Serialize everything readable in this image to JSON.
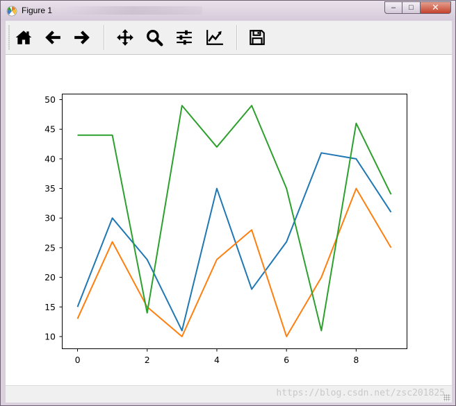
{
  "window": {
    "title": "Figure 1",
    "minimize_label": "–",
    "maximize_label": "□",
    "close_label": "✕"
  },
  "toolbar": {
    "tools": [
      {
        "name": "home-icon"
      },
      {
        "name": "back-arrow-icon"
      },
      {
        "name": "forward-arrow-icon"
      },
      {
        "name": "pan-move-icon"
      },
      {
        "name": "zoom-magnifier-icon"
      },
      {
        "name": "subplots-sliders-icon"
      },
      {
        "name": "edit-axis-curve-icon"
      },
      {
        "name": "save-floppy-icon"
      }
    ]
  },
  "status": {
    "watermark": "https://blog.csdn.net/zsc201825"
  },
  "colors": {
    "series": [
      "#1f77b4",
      "#ff7f0e",
      "#2ca02c"
    ]
  },
  "chart_data": {
    "type": "line",
    "title": "",
    "xlabel": "",
    "ylabel": "",
    "x": [
      0,
      1,
      2,
      3,
      4,
      5,
      6,
      7,
      8,
      9
    ],
    "xlim": [
      -0.45,
      9.45
    ],
    "ylim": [
      8,
      51
    ],
    "xticks": [
      0,
      2,
      4,
      6,
      8
    ],
    "yticks": [
      10,
      15,
      20,
      25,
      30,
      35,
      40,
      45,
      50
    ],
    "grid": false,
    "series": [
      {
        "values": [
          15,
          30,
          23,
          11,
          35,
          18,
          26,
          41,
          40,
          31
        ]
      },
      {
        "values": [
          13,
          26,
          15,
          10,
          23,
          28,
          10,
          20,
          35,
          25
        ]
      },
      {
        "values": [
          44,
          44,
          14,
          49,
          42,
          49,
          35,
          11,
          46,
          34
        ]
      }
    ]
  }
}
